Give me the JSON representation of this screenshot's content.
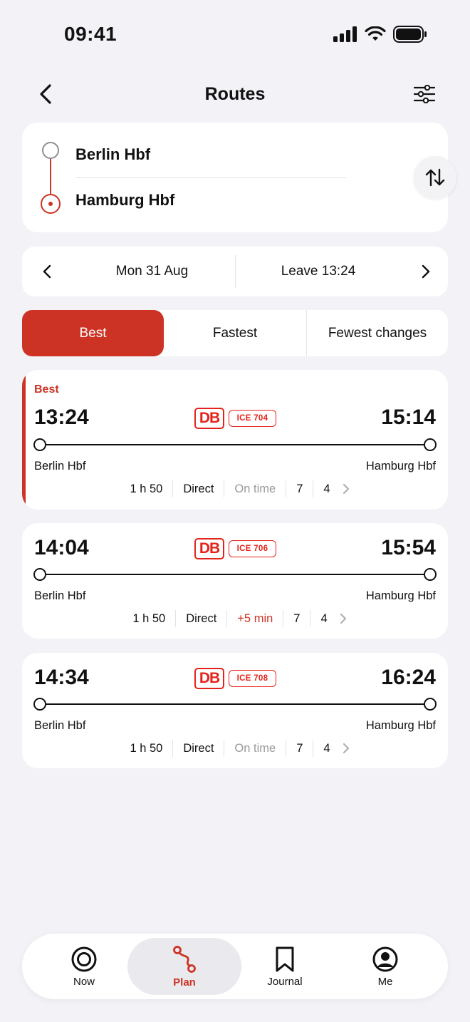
{
  "status": {
    "time": "09:41"
  },
  "nav": {
    "title": "Routes"
  },
  "stations": {
    "origin": "Berlin Hbf",
    "destination": "Hamburg Hbf"
  },
  "datebar": {
    "date": "Mon 31 Aug",
    "leave": "Leave  13:24"
  },
  "sort": {
    "tabs": [
      "Best",
      "Fastest",
      "Fewest changes"
    ],
    "active": "Best"
  },
  "routes": [
    {
      "badge": "Best",
      "dep": "13:24",
      "arr": "15:14",
      "operator": "DB",
      "train": "ICE 704",
      "from": "Berlin Hbf",
      "to": "Hamburg Hbf",
      "duration": "1 h 50",
      "changes": "Direct",
      "status": "On time",
      "status_kind": "normal",
      "num1": "7",
      "num2": "4"
    },
    {
      "dep": "14:04",
      "arr": "15:54",
      "operator": "DB",
      "train": "ICE 706",
      "from": "Berlin Hbf",
      "to": "Hamburg Hbf",
      "duration": "1 h 50",
      "changes": "Direct",
      "status": "+5 min",
      "status_kind": "delay",
      "num1": "7",
      "num2": "4"
    },
    {
      "dep": "14:34",
      "arr": "16:24",
      "operator": "DB",
      "train": "ICE 708",
      "from": "Berlin Hbf",
      "to": "Hamburg Hbf",
      "duration": "1 h 50",
      "changes": "Direct",
      "status": "On time",
      "status_kind": "normal",
      "num1": "7",
      "num2": "4"
    }
  ],
  "tabbar": {
    "items": [
      {
        "label": "Now",
        "icon": "target-icon"
      },
      {
        "label": "Plan",
        "icon": "route-icon"
      },
      {
        "label": "Journal",
        "icon": "bookmark-icon"
      },
      {
        "label": "Me",
        "icon": "profile-icon"
      }
    ],
    "active": "Plan"
  },
  "colors": {
    "accent": "#cc3324",
    "db_red": "#e4241b",
    "background": "#f2f2f7"
  }
}
